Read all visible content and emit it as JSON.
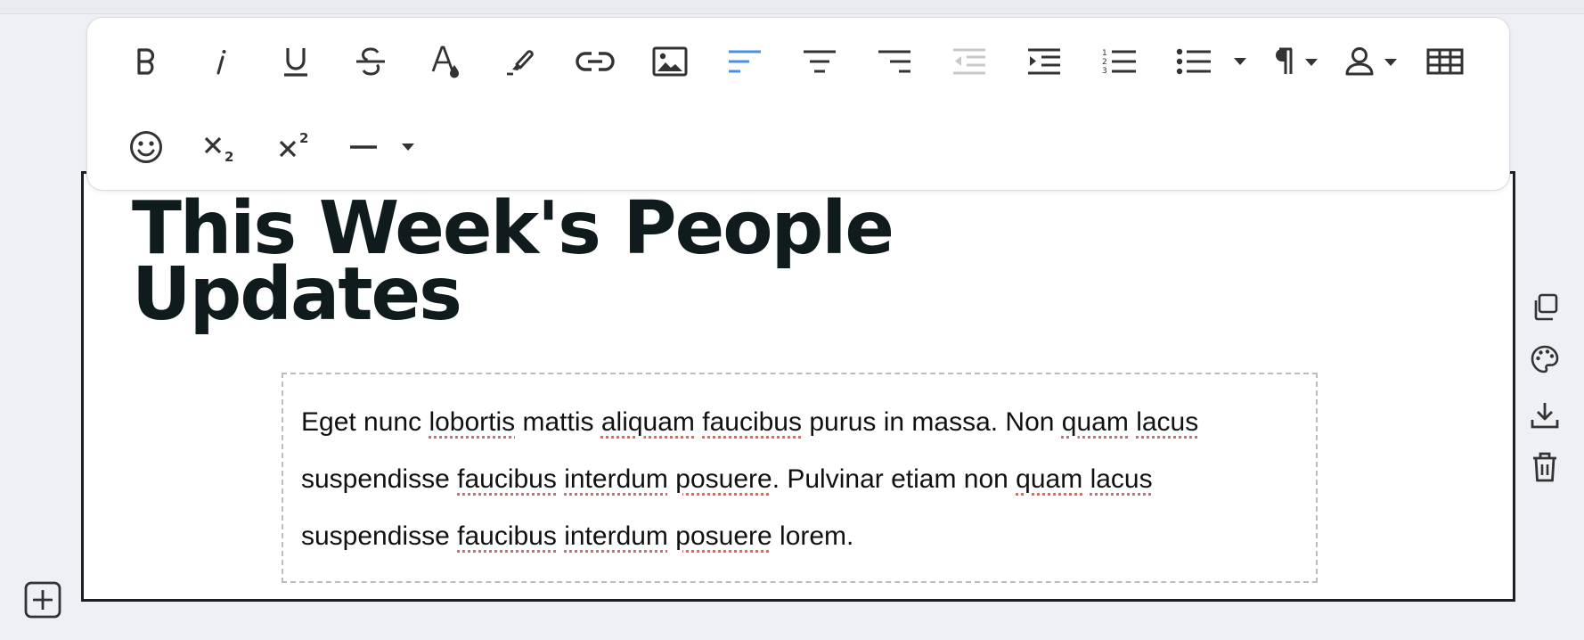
{
  "block": {
    "headline_line1": "This Week's People",
    "headline_line2": "Updates",
    "paragraph": {
      "line1": [
        {
          "t": "Eget nunc ",
          "s": false
        },
        {
          "t": "lobortis",
          "s": true
        },
        {
          "t": " mattis ",
          "s": false
        },
        {
          "t": "aliquam",
          "s": true
        },
        {
          "t": " ",
          "s": false
        },
        {
          "t": "faucibus",
          "s": true
        },
        {
          "t": " purus in massa. Non ",
          "s": false
        },
        {
          "t": "quam",
          "s": true
        },
        {
          "t": " ",
          "s": false
        },
        {
          "t": "lacus",
          "s": true
        }
      ],
      "line2": [
        {
          "t": "suspendisse ",
          "s": false
        },
        {
          "t": "faucibus",
          "s": true
        },
        {
          "t": " ",
          "s": false
        },
        {
          "t": "interdum",
          "s": true
        },
        {
          "t": " ",
          "s": false
        },
        {
          "t": "posuere",
          "s": true
        },
        {
          "t": ". Pulvinar etiam non ",
          "s": false
        },
        {
          "t": "quam",
          "s": true
        },
        {
          "t": " ",
          "s": false
        },
        {
          "t": "lacus",
          "s": true
        }
      ],
      "line3": [
        {
          "t": "suspendisse ",
          "s": false
        },
        {
          "t": "faucibus",
          "s": true
        },
        {
          "t": " ",
          "s": false
        },
        {
          "t": "interdum",
          "s": true
        },
        {
          "t": " ",
          "s": false
        },
        {
          "t": "posuere",
          "s": true
        },
        {
          "t": " lorem.",
          "s": false
        }
      ]
    }
  },
  "toolbar": {
    "row1": [
      "bold",
      "italic",
      "underline",
      "strikethrough",
      "text-color",
      "highlight",
      "link",
      "image",
      "align-left",
      "align-center",
      "align-right",
      "outdent",
      "indent",
      "ordered-list",
      "bullet-list",
      "paragraph-format",
      "personalization",
      "table"
    ],
    "row2": [
      "emoji",
      "subscript",
      "superscript",
      "horizontal-line"
    ],
    "active": "align-left",
    "disabled": "outdent"
  },
  "side_tools": [
    "duplicate",
    "palette",
    "download",
    "delete"
  ],
  "colors": {
    "accent": "#4a90e2",
    "disabled": "#c8c8c8",
    "icon": "#333333",
    "spellcheck": "#e06a5e",
    "headline": "#0f1b1c"
  }
}
